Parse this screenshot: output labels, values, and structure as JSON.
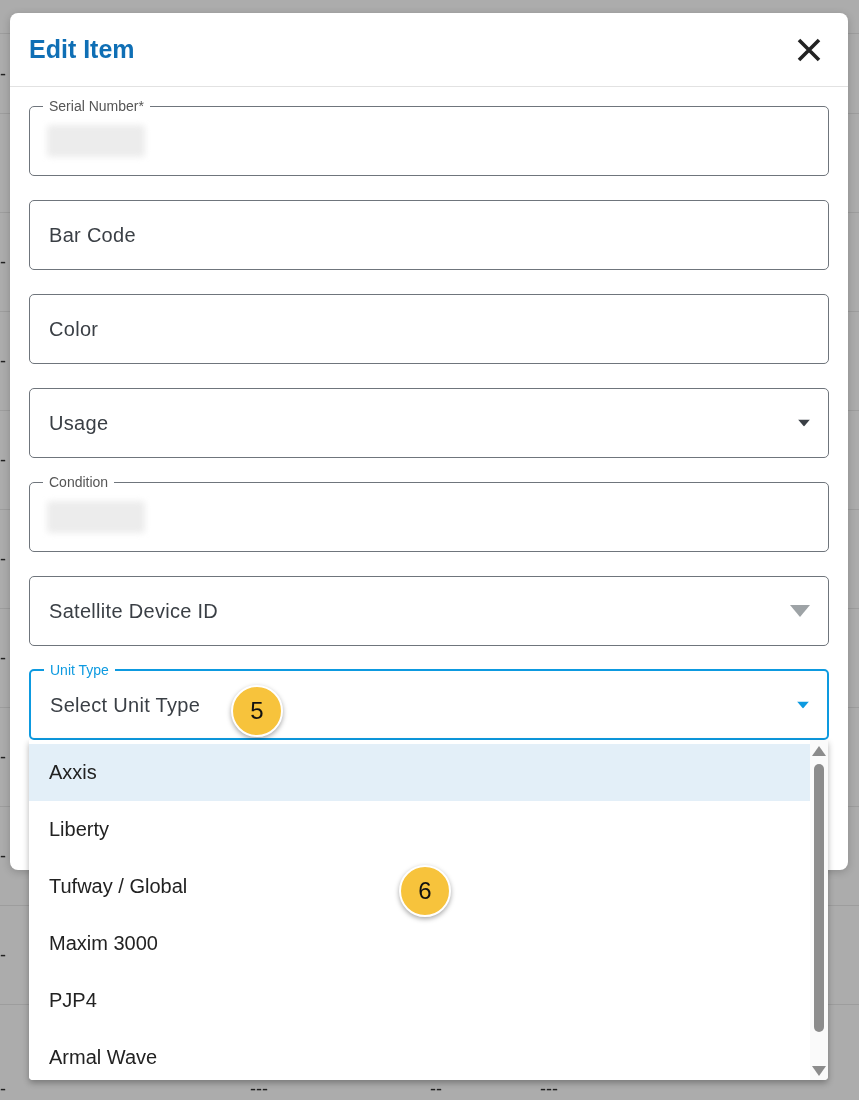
{
  "background_rows": [
    {
      "cells": [
        "-"
      ]
    },
    {},
    {
      "cells": [
        "-"
      ]
    },
    {
      "cells": [
        "-"
      ]
    },
    {
      "cells": [
        "-"
      ]
    },
    {
      "cells": [
        "-"
      ]
    },
    {
      "cells": [
        "-"
      ]
    },
    {
      "cells": [
        "-"
      ]
    },
    {
      "cells": [
        "-"
      ]
    },
    {
      "cells": [
        "-"
      ]
    },
    {
      "cells": [
        "-",
        "---",
        "--",
        "---"
      ]
    }
  ],
  "dialog": {
    "title": "Edit Item",
    "fields": [
      {
        "kind": "text",
        "label": "Serial Number*",
        "filled": true
      },
      {
        "kind": "text",
        "placeholder": "Bar Code"
      },
      {
        "kind": "text",
        "placeholder": "Color"
      },
      {
        "kind": "select",
        "placeholder": "Usage"
      },
      {
        "kind": "text",
        "label": "Condition",
        "filled": true
      },
      {
        "kind": "select",
        "placeholder": "Satellite Device ID",
        "disabled": true
      },
      {
        "kind": "select",
        "label": "Unit Type",
        "placeholder": "Select Unit Type",
        "focused": true
      }
    ]
  },
  "dropdown": {
    "options": [
      {
        "label": "Axxis",
        "selected": true
      },
      {
        "label": "Liberty",
        "selected": false
      },
      {
        "label": "Tufway / Global",
        "selected": false
      },
      {
        "label": "Maxim 3000",
        "selected": false
      },
      {
        "label": "PJP4",
        "selected": false
      },
      {
        "label": "Armal Wave",
        "selected": false
      }
    ]
  },
  "markers": [
    {
      "label": "5"
    },
    {
      "label": "6"
    }
  ]
}
